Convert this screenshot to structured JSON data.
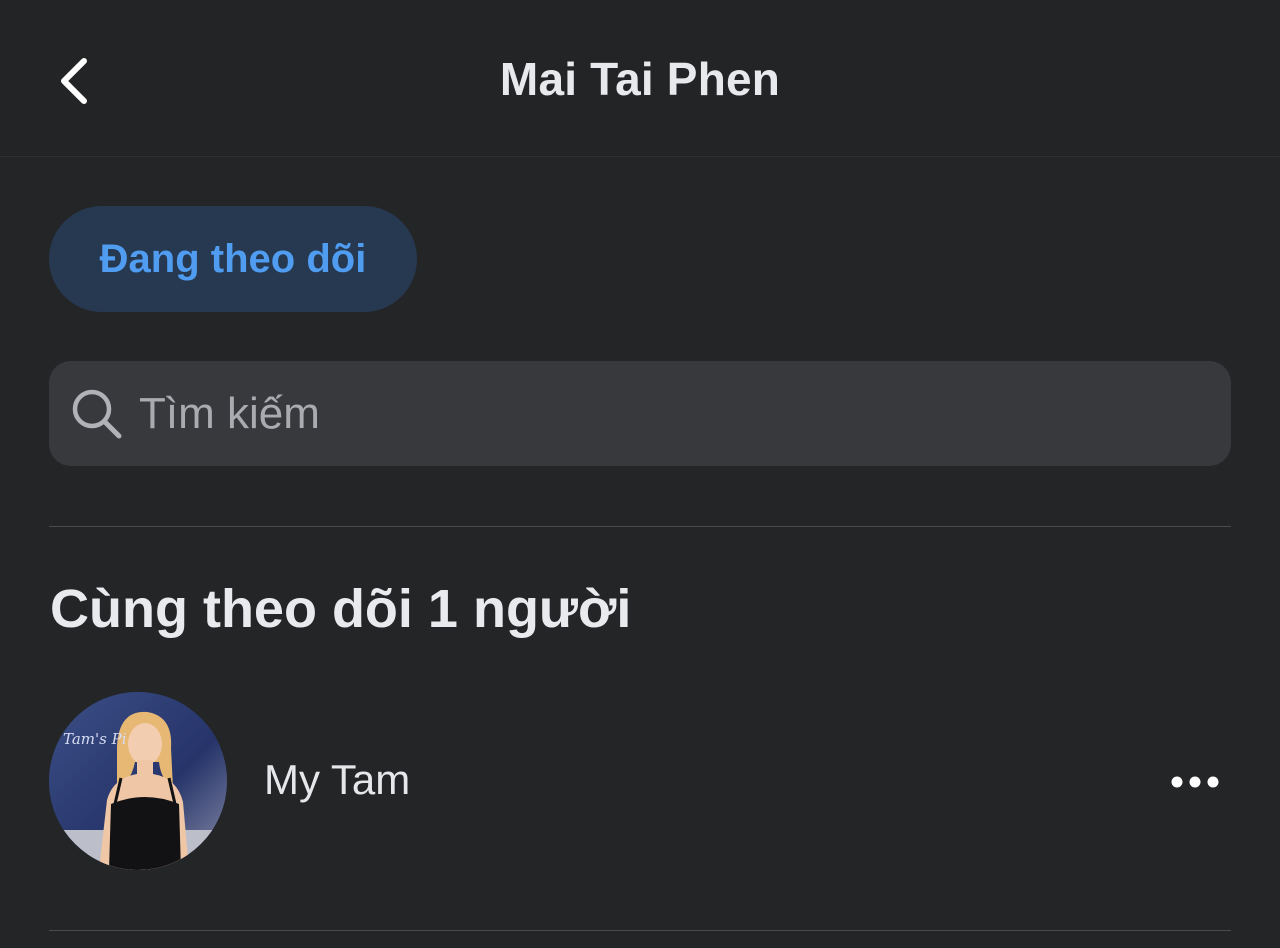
{
  "header": {
    "title": "Mai Tai Phen"
  },
  "filter_chip": {
    "label": "Đang theo dõi"
  },
  "search": {
    "placeholder": "Tìm kiếm",
    "value": ""
  },
  "section": {
    "title": "Cùng theo dõi 1 người"
  },
  "people": [
    {
      "name": "My Tam",
      "avatar_text": "Tam's Pi"
    }
  ],
  "colors": {
    "background": "#242527",
    "accent": "#4f9cf0",
    "chip_bg": "#263951",
    "search_bg": "#38393c"
  },
  "icons": {
    "back": "chevron-left-icon",
    "search": "search-icon",
    "more": "more-horizontal-icon"
  }
}
